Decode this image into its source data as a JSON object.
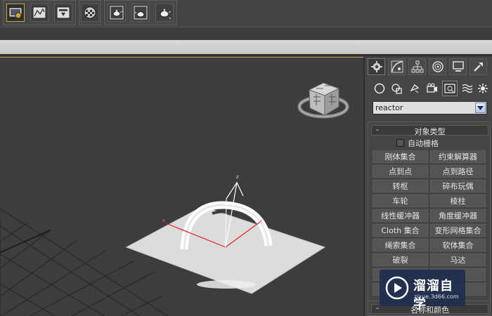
{
  "toolbar": {
    "icons": [
      "render-setup-icon",
      "rendered-frame-window-icon",
      "render-production-icon",
      "material-editor-icon",
      "render-teapot-icon",
      "render-teapot-icon",
      "render-teapot-icon"
    ]
  },
  "command_panel": {
    "tabs": [
      "create-tab",
      "modify-tab",
      "hierarchy-tab",
      "motion-tab",
      "display-tab",
      "utilities-tab"
    ],
    "category_dropdown": {
      "value": "reactor"
    },
    "object_type": {
      "minus": "-",
      "title": "对象类型",
      "auto_grid": "自动栅格",
      "buttons": [
        "刚体集合",
        "约束解算器",
        "点到点",
        "点到路径",
        "转枢",
        "碎布玩偶",
        "车轮",
        "棱柱",
        "线性缓冲器",
        "角度缓冲器",
        "Cloth 集合",
        "变形网格集合",
        "绳索集合",
        "软体集合",
        "破裂",
        "马达"
      ]
    },
    "name_color": {
      "minus": "-",
      "title": "名称和颜色"
    }
  },
  "viewport": {
    "axis_labels": {
      "z": "z",
      "x1": "x",
      "x2": "x"
    }
  },
  "watermark": {
    "brand": "溜溜自学",
    "url": "zixue.3d66.com"
  },
  "colors": {
    "accent": "#c9a33a",
    "viewport_bg": "#3d3d3d",
    "panel_bg": "#454545"
  }
}
